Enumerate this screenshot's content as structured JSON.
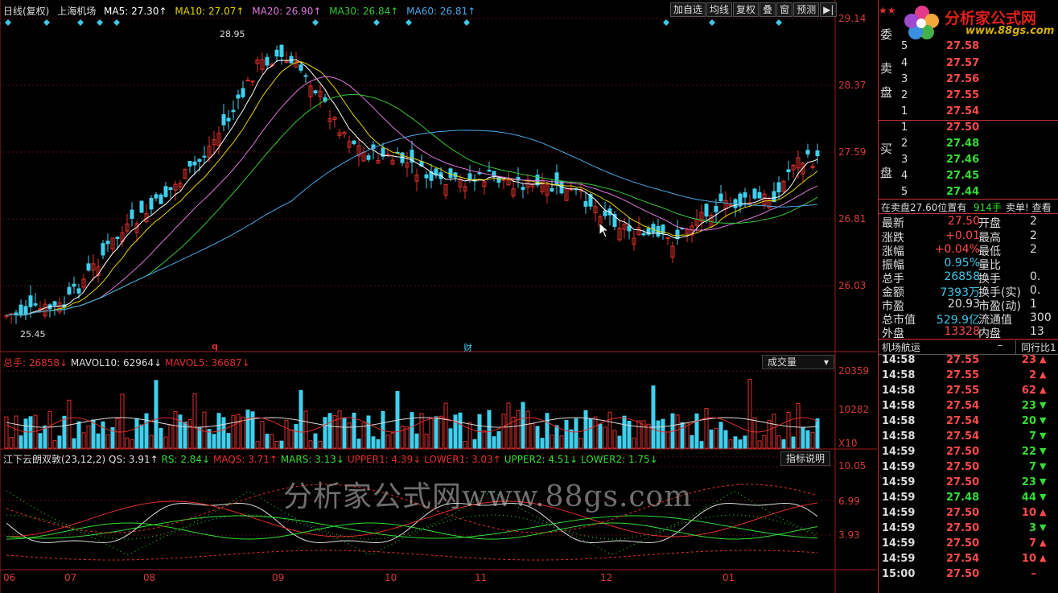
{
  "header": {
    "period": "日线(复权)",
    "stock_name": "上海机场",
    "ma5": "MA5: 27.30↑",
    "ma10": "MA10: 27.07↑",
    "ma20": "MA20: 26.90↑",
    "ma30": "MA30: 26.84↑",
    "ma60": "MA60: 26.81↑"
  },
  "toolbar": [
    "加自选",
    "均线",
    "复权",
    "叠",
    "窗",
    "预测",
    "▶|"
  ],
  "colors": {
    "up": "#e0302c",
    "down": "#3fd0ee",
    "ma5": "#ffffff",
    "ma10": "#e6d200",
    "ma20": "#dd77dd",
    "ma30": "#34c834",
    "ma60": "#4aa8e8",
    "axis": "#a01e1e"
  },
  "price_axis": [
    "29.14",
    "28.37",
    "27.59",
    "26.81",
    "26.03"
  ],
  "annotations": {
    "high": "28.95",
    "low": "25.45",
    "q_marker": "q",
    "cai_marker": "财"
  },
  "volume_panel": {
    "total": "总手: 26858↓",
    "mavol10": "MAVOL10: 62964↓",
    "mavol5": "MAVOL5: 36687↓",
    "button": "成交量",
    "axis": [
      "20359",
      "10282"
    ],
    "multiplier": "X10"
  },
  "indicator_panel": {
    "name": "江下云朗双敦(23,12,2)",
    "qs": "QS: 3.91↑",
    "rs": "RS: 2.84↓",
    "maqs": "MAQS: 3.71↑",
    "mars": "MARS: 3.13↓",
    "upper1": "UPPER1: 4.39↓",
    "lower1": "LOWER1: 3.03↑",
    "upper2": "UPPER2: 4.51↓",
    "lower2": "LOWER2: 1.75↓",
    "button": "指标说明",
    "axis": [
      "10.05",
      "6.99",
      "3.93"
    ]
  },
  "months": [
    "06",
    "07",
    "08",
    "09",
    "10",
    "11",
    "12",
    "01"
  ],
  "watermark": "分析家公式网www.88gs.com",
  "logo": {
    "text": "分析家公式网",
    "url": "www.88gs.com"
  },
  "orderbook": {
    "sell_label": [
      "委",
      "卖",
      "盘"
    ],
    "buy_label": [
      "买",
      "盘"
    ],
    "sell": [
      {
        "lvl": "5",
        "price": "27.58"
      },
      {
        "lvl": "4",
        "price": "27.57"
      },
      {
        "lvl": "3",
        "price": "27.56"
      },
      {
        "lvl": "2",
        "price": "27.55"
      },
      {
        "lvl": "1",
        "price": "27.54"
      }
    ],
    "buy": [
      {
        "lvl": "1",
        "price": "27.50"
      },
      {
        "lvl": "2",
        "price": "27.48"
      },
      {
        "lvl": "3",
        "price": "27.46"
      },
      {
        "lvl": "4",
        "price": "27.45"
      },
      {
        "lvl": "5",
        "price": "27.44"
      }
    ],
    "status_line": "在卖盘27.60位置有",
    "status_qty": "914手",
    "status_link": "卖单! 查看"
  },
  "quote": [
    {
      "k": "最新",
      "v": "27.50",
      "vc": "red",
      "k2": "开盘",
      "v2": "2"
    },
    {
      "k": "涨跌",
      "v": "+0.01",
      "vc": "red",
      "k2": "最高",
      "v2": "2"
    },
    {
      "k": "涨幅",
      "v": "+0.04%",
      "vc": "red",
      "k2": "最低",
      "v2": "2"
    },
    {
      "k": "振幅",
      "v": "0.95%",
      "vc": "cyn",
      "k2": "量比",
      "v2": ""
    },
    {
      "k": "总手",
      "v": "26858",
      "vc": "cyn",
      "k2": "换手",
      "v2": "0."
    },
    {
      "k": "金额",
      "v": "7393万",
      "vc": "cyn",
      "k2": "换手(实)",
      "v2": "0."
    },
    {
      "k": "市盈",
      "v": "20.93",
      "vc": "wht",
      "k2": "市盈(动)",
      "v2": "1"
    },
    {
      "k": "总市值",
      "v": "529.9亿",
      "vc": "cyn",
      "k2": "流通值",
      "v2": "300"
    },
    {
      "k": "外盘",
      "v": "13328",
      "vc": "red",
      "k2": "内盘",
      "v2": "13"
    }
  ],
  "tabs": {
    "left": "机场航运",
    "right": "同行比1"
  },
  "ticks": [
    {
      "t": "14:58",
      "p": "27.55",
      "pc": "red",
      "v": "23",
      "d": "up"
    },
    {
      "t": "14:58",
      "p": "27.55",
      "pc": "red",
      "v": "2",
      "d": "up"
    },
    {
      "t": "14:58",
      "p": "27.55",
      "pc": "red",
      "v": "62",
      "d": "up"
    },
    {
      "t": "14:58",
      "p": "27.54",
      "pc": "red",
      "v": "23",
      "d": "down"
    },
    {
      "t": "14:58",
      "p": "27.54",
      "pc": "red",
      "v": "20",
      "d": "down"
    },
    {
      "t": "14:58",
      "p": "27.54",
      "pc": "red",
      "v": "7",
      "d": "down"
    },
    {
      "t": "14:59",
      "p": "27.50",
      "pc": "red",
      "v": "22",
      "d": "down"
    },
    {
      "t": "14:59",
      "p": "27.50",
      "pc": "red",
      "v": "7",
      "d": "down"
    },
    {
      "t": "14:59",
      "p": "27.50",
      "pc": "red",
      "v": "23",
      "d": "down"
    },
    {
      "t": "14:59",
      "p": "27.48",
      "pc": "grn",
      "v": "44",
      "d": "down"
    },
    {
      "t": "14:59",
      "p": "27.50",
      "pc": "red",
      "v": "10",
      "d": "up"
    },
    {
      "t": "14:59",
      "p": "27.50",
      "pc": "red",
      "v": "3",
      "d": "down"
    },
    {
      "t": "14:59",
      "p": "27.50",
      "pc": "red",
      "v": "7",
      "d": "up"
    },
    {
      "t": "14:59",
      "p": "27.54",
      "pc": "red",
      "v": "10",
      "d": "up"
    },
    {
      "t": "15:00",
      "p": "27.50",
      "pc": "red",
      "v": "–",
      "d": "none"
    }
  ]
}
